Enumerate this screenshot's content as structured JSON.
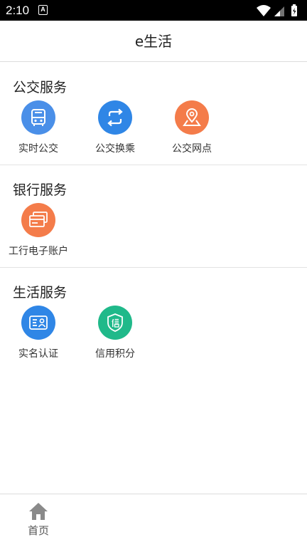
{
  "status_bar": {
    "time": "2:10",
    "notification_icon": "A"
  },
  "header": {
    "title": "e生活"
  },
  "sections": [
    {
      "title": "公交服务",
      "items": [
        {
          "label": "实时公交",
          "icon": "bus-icon",
          "color": "#4a8fe8"
        },
        {
          "label": "公交换乘",
          "icon": "transfer-icon",
          "color": "#2f86e6"
        },
        {
          "label": "公交网点",
          "icon": "map-pin-icon",
          "color": "#f47c4a"
        }
      ]
    },
    {
      "title": "银行服务",
      "items": [
        {
          "label": "工行电子账户",
          "icon": "bank-card-icon",
          "color": "#f47c4a"
        }
      ]
    },
    {
      "title": "生活服务",
      "items": [
        {
          "label": "实名认证",
          "icon": "id-card-icon",
          "color": "#2f86e6"
        },
        {
          "label": "信用积分",
          "icon": "credit-shield-icon",
          "color": "#20b98a"
        }
      ]
    }
  ],
  "bottom_nav": {
    "tabs": [
      {
        "label": "首页",
        "icon": "home-icon",
        "color": "#8a8a8a"
      }
    ]
  }
}
